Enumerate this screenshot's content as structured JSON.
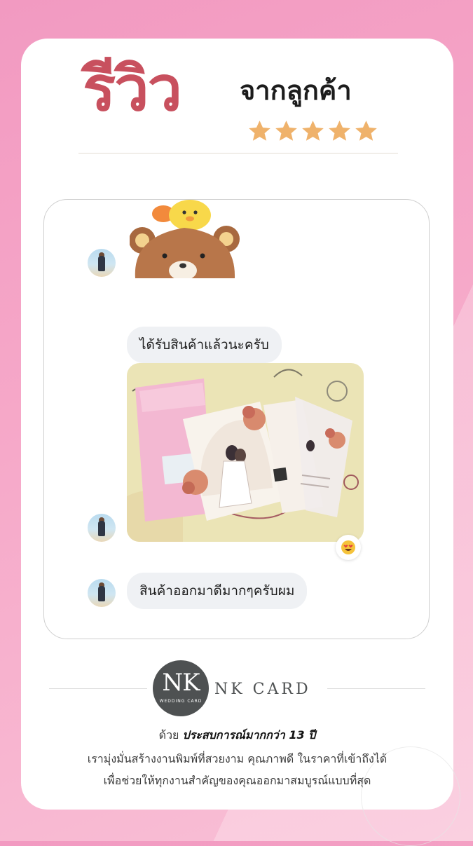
{
  "header": {
    "title": "รีวิว",
    "subtitle": "จากลูกค้า",
    "rating_stars": 5,
    "colors": {
      "title": "#c8505e",
      "stars": "#efb26b",
      "background": "#f29ac1"
    }
  },
  "chat": {
    "messages": [
      {
        "type": "sticker",
        "sticker_name": "rilakkuma-bear-with-chick-sticker"
      },
      {
        "type": "text",
        "text": "ได้รับสินค้าแล้วนะครับ"
      },
      {
        "type": "photo",
        "description_icon": "wedding-invitation-photo",
        "reaction": "heart-eyes-emoji"
      },
      {
        "type": "text",
        "text": "สินค้าออกมาดีมากๆครับผม"
      }
    ]
  },
  "footer": {
    "logo_text": "NK",
    "logo_subtext": "WEDDING CARD",
    "brand_name": "NK CARD",
    "tagline_prefix": "ด้วย",
    "tagline_emphasis": "ประสบการณ์มากกว่า 13 ปี",
    "line2": "เรามุ่งมั่นสร้างงานพิมพ์ที่สวยงาม คุณภาพดี ในราคาที่เข้าถึงได้",
    "line3": "เพื่อช่วยให้ทุกงานสำคัญของคุณออกมาสมบูรณ์แบบที่สุด"
  }
}
